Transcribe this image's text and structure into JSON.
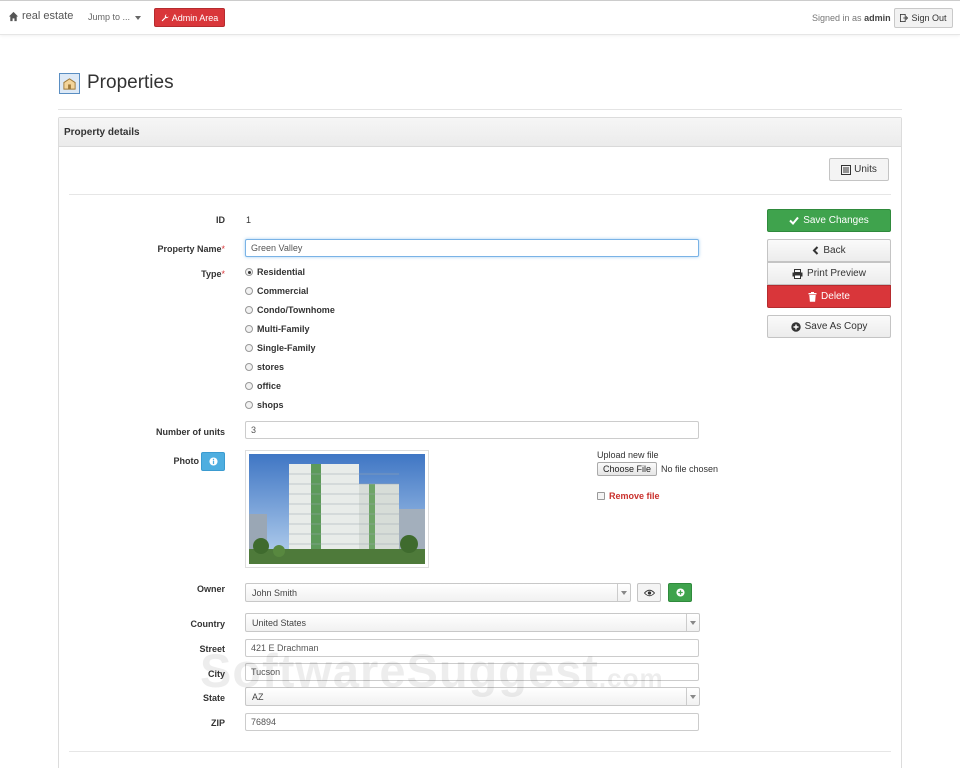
{
  "navbar": {
    "brand": "real estate",
    "jump_label": "Jump to ...",
    "admin_label": "Admin Area",
    "signed_in_prefix": "Signed in as",
    "signed_in_user": "admin",
    "signout_label": "Sign Out"
  },
  "page": {
    "title": "Properties"
  },
  "panel": {
    "title": "Property details",
    "units_label": "Units"
  },
  "form": {
    "id_label": "ID",
    "id_value": "1",
    "name_label": "Property Name",
    "name_value": "Green Valley",
    "type_label": "Type",
    "required_mark": "*",
    "types": [
      "Residential",
      "Commercial",
      "Condo/Townhome",
      "Multi-Family",
      "Single-Family",
      "stores",
      "office",
      "shops"
    ],
    "selected_type": "Residential",
    "units_label": "Number of units",
    "units_value": "3",
    "photo_label": "Photo",
    "upload_label": "Upload new file",
    "choose_file_label": "Choose File",
    "no_file_label": "No file chosen",
    "remove_file_label": "Remove file",
    "owner_label": "Owner",
    "owner_value": "John Smith",
    "country_label": "Country",
    "country_value": "United States",
    "street_label": "Street",
    "street_value": "421 E Drachman",
    "city_label": "City",
    "city_value": "Tucson",
    "state_label": "State",
    "state_value": "AZ",
    "zip_label": "ZIP",
    "zip_value": "76894"
  },
  "actions": {
    "save": "Save Changes",
    "back": "Back",
    "print": "Print Preview",
    "delete": "Delete",
    "save_copy": "Save As Copy"
  },
  "watermark": {
    "main": "SoftwareSuggest",
    "suffix": ".com"
  },
  "colors": {
    "green": "#3fa34d",
    "red": "#d9363a",
    "info": "#4eaee0"
  }
}
